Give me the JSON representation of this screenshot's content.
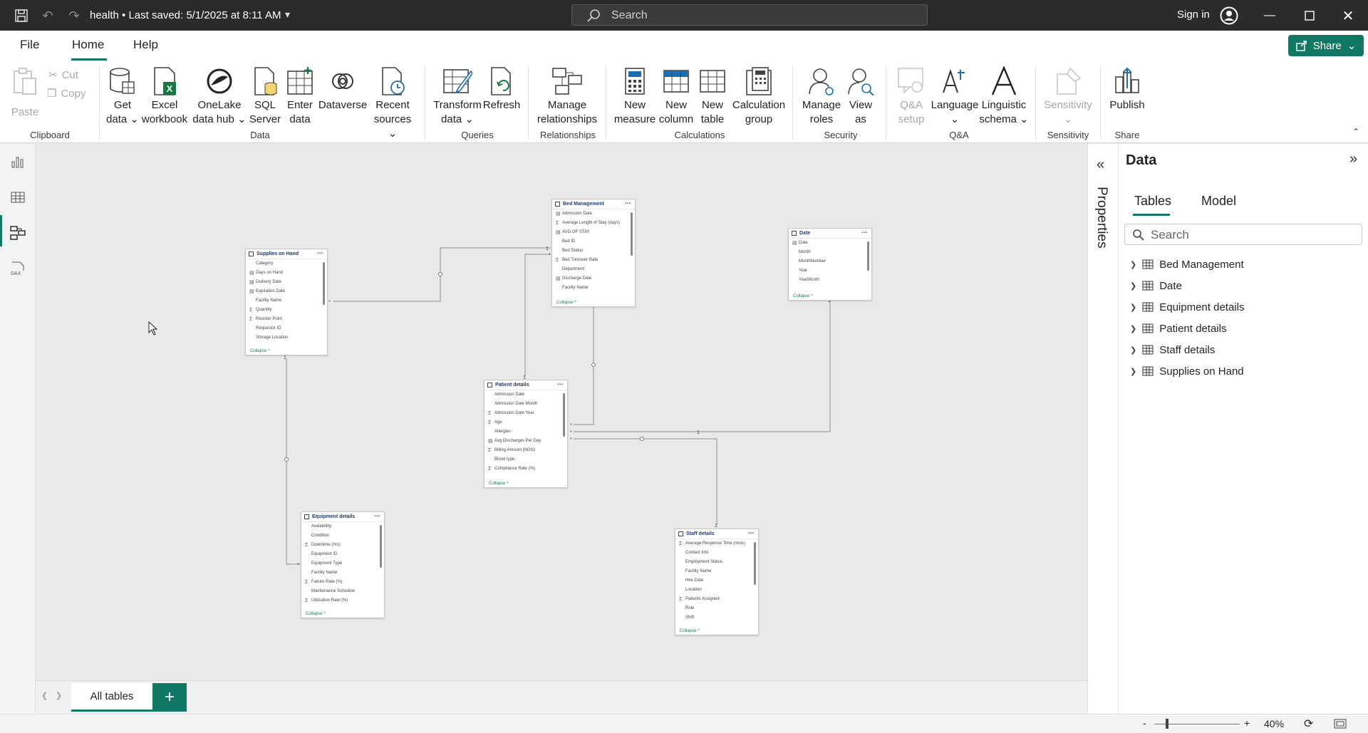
{
  "titlebar": {
    "title": "health • Last saved: 5/1/2025 at 8:11 AM",
    "search_placeholder": "Search",
    "signin_label": "Sign in"
  },
  "menu": {
    "file": "File",
    "home": "Home",
    "help": "Help",
    "share": "Share"
  },
  "ribbon": {
    "clipboard": {
      "paste": "Paste",
      "cut": "Cut",
      "copy": "Copy",
      "group": "Clipboard"
    },
    "data": {
      "get_data": [
        "Get",
        "data"
      ],
      "excel": [
        "Excel",
        "workbook"
      ],
      "onelake": [
        "OneLake",
        "data hub"
      ],
      "sql": [
        "SQL",
        "Server"
      ],
      "enter": [
        "Enter",
        "data"
      ],
      "dataverse": "Dataverse",
      "recent": [
        "Recent",
        "sources"
      ],
      "group": "Data"
    },
    "queries": {
      "transform": [
        "Transform",
        "data"
      ],
      "refresh": "Refresh",
      "group": "Queries"
    },
    "relationships": {
      "manage": [
        "Manage",
        "relationships"
      ],
      "group": "Relationships"
    },
    "calculations": {
      "new_measure": [
        "New",
        "measure"
      ],
      "new_column": [
        "New",
        "column"
      ],
      "new_table": [
        "New",
        "table"
      ],
      "calc_group": [
        "Calculation",
        "group"
      ],
      "group": "Calculations"
    },
    "security": {
      "manage_roles": [
        "Manage",
        "roles"
      ],
      "view_as": [
        "View",
        "as"
      ],
      "group": "Security"
    },
    "qa": {
      "qa_setup": [
        "Q&A",
        "setup"
      ],
      "language": "Language",
      "linguistic": [
        "Linguistic",
        "schema"
      ],
      "group": "Q&A"
    },
    "sensitivity": {
      "sensitivity": "Sensitivity",
      "group": "Sensitivity"
    },
    "share": {
      "publish": "Publish",
      "group": "Share"
    }
  },
  "canvas": {
    "tables": [
      {
        "id": "supplies",
        "name": "Supplies on Hand",
        "fields": [
          {
            "icon": "",
            "label": "Category"
          },
          {
            "icon": "cal",
            "label": "Days on Hand"
          },
          {
            "icon": "cal",
            "label": "Delivery Date"
          },
          {
            "icon": "cal",
            "label": "Expiration Date"
          },
          {
            "icon": "",
            "label": "Facility Name"
          },
          {
            "icon": "sum",
            "label": "Quantity"
          },
          {
            "icon": "sum",
            "label": "Reorder Point"
          },
          {
            "icon": "",
            "label": "Requestor ID"
          },
          {
            "icon": "",
            "label": "Storage Location"
          }
        ],
        "collapse": "Collapse ^"
      },
      {
        "id": "bed",
        "name": "Bed Management",
        "fields": [
          {
            "icon": "cal",
            "label": "Admission Date"
          },
          {
            "icon": "sum",
            "label": "Average Length of Stay (days)"
          },
          {
            "icon": "cal",
            "label": "AVG OF STAY"
          },
          {
            "icon": "",
            "label": "Bed ID"
          },
          {
            "icon": "",
            "label": "Bed Status"
          },
          {
            "icon": "sum",
            "label": "Bed Turnover Rate"
          },
          {
            "icon": "",
            "label": "Department"
          },
          {
            "icon": "cal",
            "label": "Discharge Date"
          },
          {
            "icon": "",
            "label": "Facility Name"
          }
        ],
        "collapse": "Collapse ^"
      },
      {
        "id": "date",
        "name": "Date",
        "fields": [
          {
            "icon": "cal",
            "label": "Date"
          },
          {
            "icon": "",
            "label": "Month"
          },
          {
            "icon": "",
            "label": "MonthNumber"
          },
          {
            "icon": "",
            "label": "Year"
          },
          {
            "icon": "",
            "label": "YearMonth"
          }
        ],
        "collapse": "Collapse ^"
      },
      {
        "id": "patient",
        "name": "Patient details",
        "fields": [
          {
            "icon": "",
            "label": "Admission Date"
          },
          {
            "icon": "",
            "label": "Admission Date Month"
          },
          {
            "icon": "sum",
            "label": "Admission Date Year"
          },
          {
            "icon": "sum",
            "label": "Age"
          },
          {
            "icon": "",
            "label": "Allergies"
          },
          {
            "icon": "cal",
            "label": "Avg Discharges Per Day"
          },
          {
            "icon": "sum",
            "label": "Billing Amount (NGN)"
          },
          {
            "icon": "",
            "label": "Blood type"
          },
          {
            "icon": "sum",
            "label": "Compliance Rate (%)"
          }
        ],
        "collapse": "Collapse ^"
      },
      {
        "id": "equipment",
        "name": "Equipment details",
        "fields": [
          {
            "icon": "",
            "label": "Availability"
          },
          {
            "icon": "",
            "label": "Condition"
          },
          {
            "icon": "sum",
            "label": "Downtime (hrs)"
          },
          {
            "icon": "",
            "label": "Equipment ID"
          },
          {
            "icon": "",
            "label": "Equipment Type"
          },
          {
            "icon": "",
            "label": "Facility Name"
          },
          {
            "icon": "sum",
            "label": "Failure Rate (%)"
          },
          {
            "icon": "",
            "label": "Maintenance Schedule"
          },
          {
            "icon": "sum",
            "label": "Utilization Rate (%)"
          }
        ],
        "collapse": "Collapse ^"
      },
      {
        "id": "staff",
        "name": "Staff details",
        "fields": [
          {
            "icon": "sum",
            "label": "Average Response Time (mins)"
          },
          {
            "icon": "",
            "label": "Contact Info"
          },
          {
            "icon": "",
            "label": "Employment Status"
          },
          {
            "icon": "",
            "label": "Facility Name"
          },
          {
            "icon": "",
            "label": "Hire Date"
          },
          {
            "icon": "",
            "label": "Location"
          },
          {
            "icon": "sum",
            "label": "Patients Assigned"
          },
          {
            "icon": "",
            "label": "Role"
          },
          {
            "icon": "",
            "label": "Shift"
          }
        ],
        "collapse": "Collapse ^"
      }
    ],
    "relationship_labels": {
      "one": "1",
      "many": "*"
    }
  },
  "bottombar": {
    "tab_all": "All tables",
    "add": "+"
  },
  "properties": {
    "label": "Properties"
  },
  "datapane": {
    "title": "Data",
    "tabs": [
      "Tables",
      "Model"
    ],
    "search_placeholder": "Search",
    "tables": [
      "Bed Management",
      "Date",
      "Equipment details",
      "Patient details",
      "Staff details",
      "Supplies on Hand"
    ]
  },
  "statusbar": {
    "zoom": "40%",
    "minus": "-",
    "plus": "+"
  },
  "colors": {
    "accent": "#117865",
    "titlebar": "#2b2b2b"
  }
}
